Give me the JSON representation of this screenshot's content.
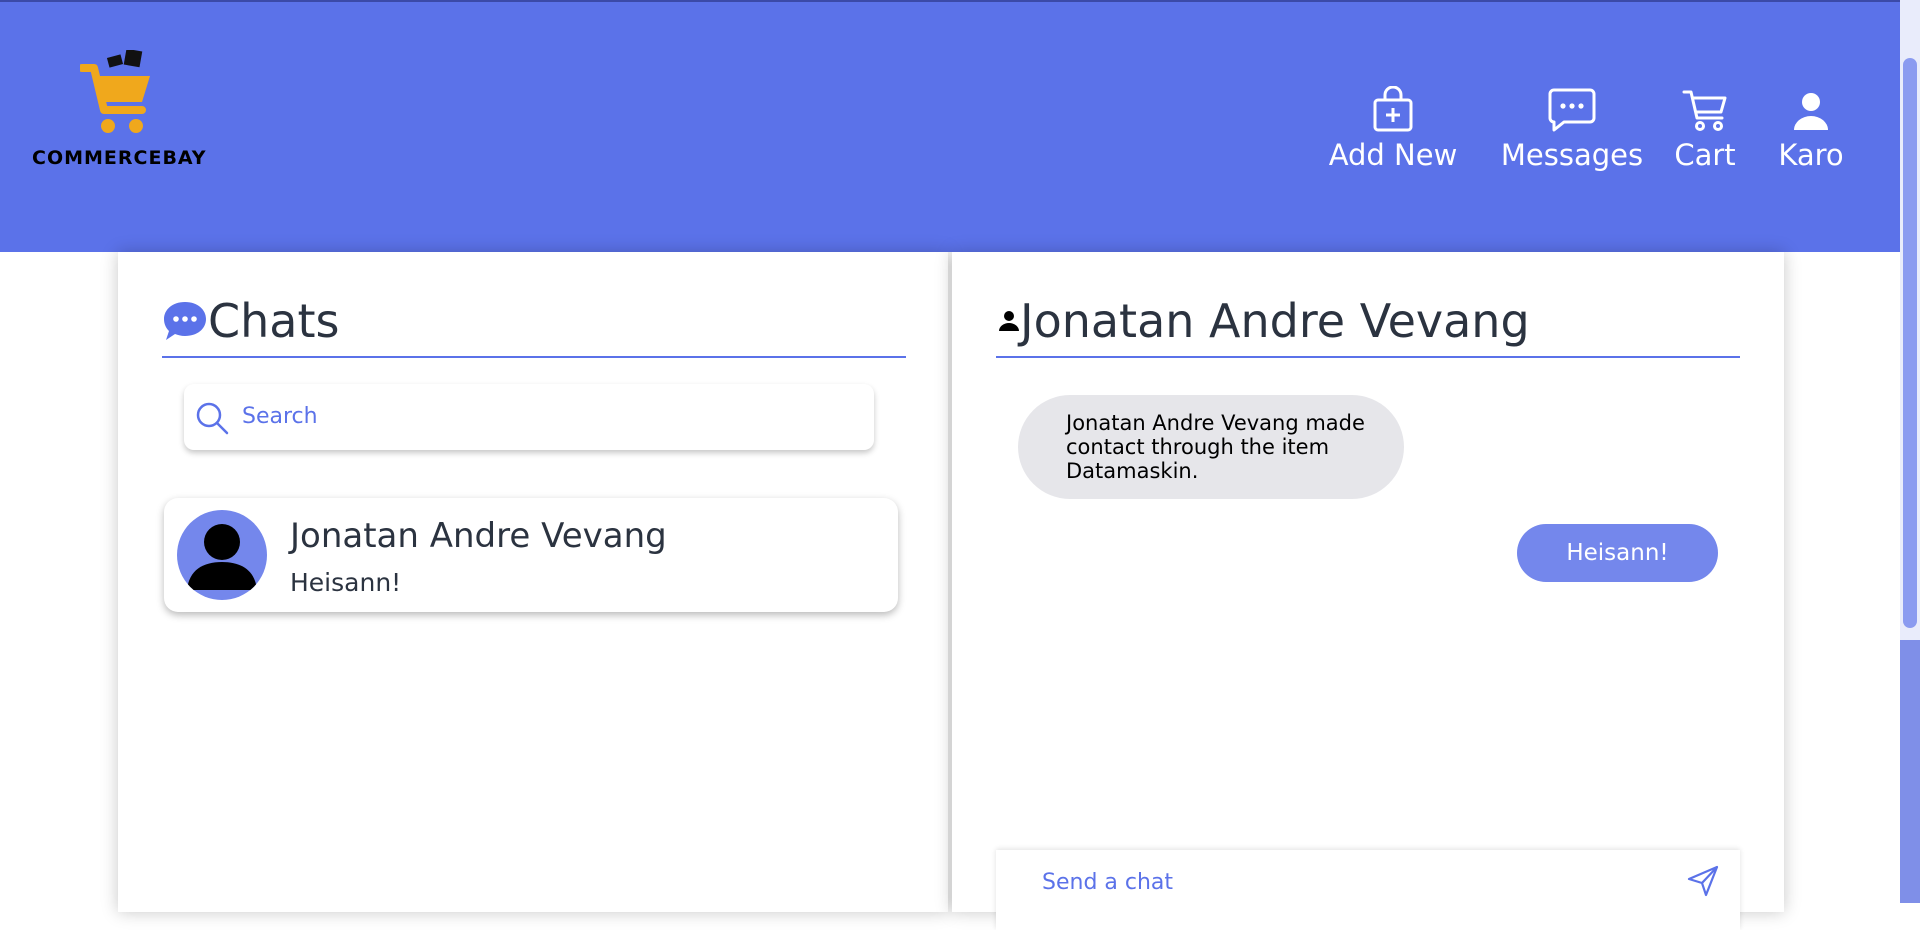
{
  "brand": {
    "name": "COMMERCEBAY"
  },
  "nav": {
    "add_new": "Add New",
    "messages": "Messages",
    "cart": "Cart",
    "user": "Karo"
  },
  "chats_panel": {
    "title": "Chats",
    "search_placeholder": "Search",
    "items": [
      {
        "name": "Jonatan Andre Vevang",
        "last_message": "Heisann!"
      }
    ]
  },
  "conversation": {
    "title": "Jonatan Andre Vevang",
    "messages": [
      {
        "direction": "incoming",
        "text": "Jonatan Andre Vevang made contact through the item Datamaskin."
      },
      {
        "direction": "outgoing",
        "text": "Heisann!"
      }
    ],
    "compose_placeholder": "Send a chat"
  },
  "colors": {
    "header": "#5b72e9",
    "accent": "#7487ec",
    "incoming_bubble": "#e6e6ea",
    "logo_cart": "#f0a81c"
  },
  "icons": {
    "add_new": "bag-plus-icon",
    "messages": "chat-dots-icon",
    "cart": "cart-icon",
    "user": "person-icon",
    "search": "search-icon",
    "send": "send-icon"
  }
}
